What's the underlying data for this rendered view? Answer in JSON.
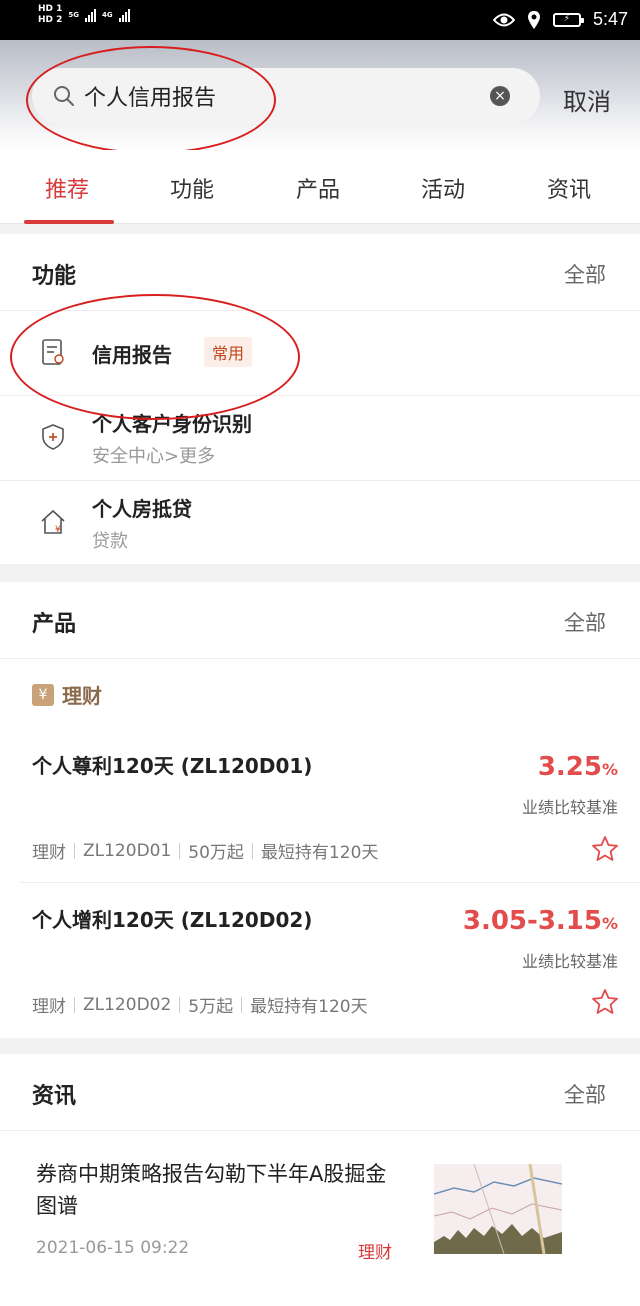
{
  "status_bar": {
    "hd1": "HD 1",
    "hd2": "HD 2",
    "net1": "5G",
    "net2": "4G",
    "time": "5:47"
  },
  "search": {
    "query": "个人信用报告",
    "cancel_label": "取消"
  },
  "tabs": [
    "推荐",
    "功能",
    "产品",
    "活动",
    "资讯"
  ],
  "functions": {
    "title": "功能",
    "all_label": "全部",
    "items": [
      {
        "title": "信用报告",
        "badge": "常用",
        "icon": "document-icon"
      },
      {
        "title": "个人客户身份识别",
        "subtitle": "安全中心>更多",
        "icon": "shield-plus-icon"
      },
      {
        "title": "个人房抵贷",
        "subtitle": "贷款",
        "icon": "house-yen-icon"
      }
    ]
  },
  "products": {
    "title": "产品",
    "all_label": "全部",
    "category": {
      "icon": "¥",
      "label": "理财"
    },
    "items": [
      {
        "name": "个人尊利120天 (ZL120D01)",
        "rate": "3.25",
        "rate_unit": "%",
        "rate_label": "业绩比较基准",
        "tags": [
          "理财",
          "ZL120D01",
          "50万起",
          "最短持有120天"
        ]
      },
      {
        "name": "个人增利120天 (ZL120D02)",
        "rate": "3.05-3.15",
        "rate_unit": "%",
        "rate_label": "业绩比较基准",
        "tags": [
          "理财",
          "ZL120D02",
          "5万起",
          "最短持有120天"
        ]
      }
    ]
  },
  "news": {
    "title": "资讯",
    "all_label": "全部",
    "items": [
      {
        "title": "券商中期策略报告勾勒下半年A股掘金图谱",
        "date": "2021-06-15 09:22",
        "tag": "理财"
      }
    ]
  },
  "colors": {
    "accent": "#d83a3a",
    "rate": "#e24c4c",
    "category": "#c9a27a",
    "annotation": "#d81e1e"
  }
}
